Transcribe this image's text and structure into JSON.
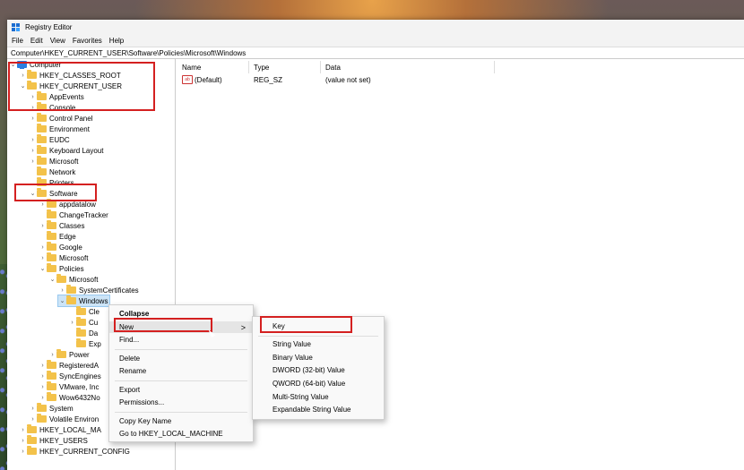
{
  "window": {
    "title": "Registry Editor"
  },
  "menubar": [
    "File",
    "Edit",
    "View",
    "Favorites",
    "Help"
  ],
  "address": "Computer\\HKEY_CURRENT_USER\\Software\\Policies\\Microsoft\\Windows",
  "tree": [
    "Computer",
    "HKEY_CLASSES_ROOT",
    "HKEY_CURRENT_USER",
    "AppEvents",
    "Console",
    "Control Panel",
    "Environment",
    "EUDC",
    "Keyboard Layout",
    "Microsoft",
    "Network",
    "Printers",
    "Software",
    "appdatalow",
    "ChangeTracker",
    "Classes",
    "Edge",
    "Google",
    "Microsoft",
    "Policies",
    "Microsoft",
    "SystemCertificates",
    "Windows",
    "Cle",
    "Cu",
    "Da",
    "Exp",
    "Power",
    "RegisteredA",
    "SyncEngines",
    "VMware, Inc",
    "Wow6432No",
    "System",
    "Volatile Environ",
    "HKEY_LOCAL_MA",
    "HKEY_USERS",
    "HKEY_CURRENT_CONFIG"
  ],
  "columns": {
    "name": "Name",
    "type": "Type",
    "data": "Data"
  },
  "values": [
    {
      "name": "(Default)",
      "type": "REG_SZ",
      "data": "(value not set)",
      "icon": "ab-icon"
    }
  ],
  "context_menu": [
    "Collapse",
    "New",
    "Find...",
    "Delete",
    "Rename",
    "Export",
    "Permissions...",
    "Copy Key Name",
    "Go to HKEY_LOCAL_MACHINE"
  ],
  "context_menu_arrow": ">",
  "submenu": [
    "Key",
    "String Value",
    "Binary Value",
    "DWORD (32-bit) Value",
    "QWORD (64-bit) Value",
    "Multi-String Value",
    "Expandable String Value"
  ],
  "colors": {
    "highlight_box": "#d42020",
    "selection": "#cce4f7",
    "folder": "#f3c24a"
  }
}
